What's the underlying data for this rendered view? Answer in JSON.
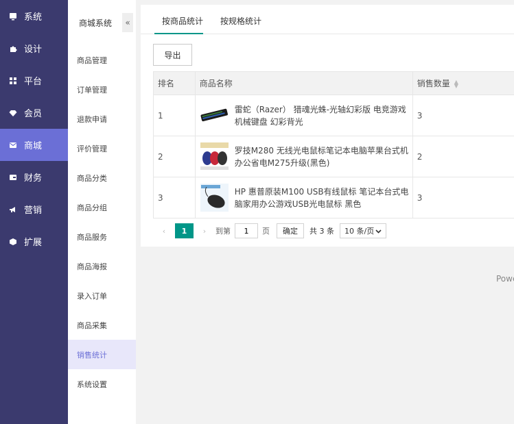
{
  "nav": {
    "items": [
      {
        "label": "系统",
        "icon": "monitor-icon"
      },
      {
        "label": "设计",
        "icon": "puzzle-icon"
      },
      {
        "label": "平台",
        "icon": "grid-icon"
      },
      {
        "label": "会员",
        "icon": "diamond-icon"
      },
      {
        "label": "商城",
        "icon": "mail-icon"
      },
      {
        "label": "财务",
        "icon": "wallet-icon"
      },
      {
        "label": "营销",
        "icon": "megaphone-icon"
      },
      {
        "label": "扩展",
        "icon": "box-icon"
      }
    ],
    "active_index": 4,
    "active_color": "#6b6fd6",
    "bg_color": "#3b3a6e"
  },
  "submenu": {
    "title": "商城系统",
    "collapse_icon": "«",
    "items": [
      "商品管理",
      "订单管理",
      "退款申请",
      "评价管理",
      "商品分类",
      "商品分组",
      "商品服务",
      "商品海报",
      "录入订单",
      "商品采集",
      "销售统计",
      "系统设置"
    ],
    "active_index": 10
  },
  "tabs": [
    {
      "label": "按商品统计",
      "active": true
    },
    {
      "label": "按规格统计",
      "active": false
    }
  ],
  "toolbar": {
    "export_label": "导出"
  },
  "table": {
    "headers": [
      "排名",
      "商品名称",
      "销售数量"
    ],
    "rows": [
      {
        "rank": "1",
        "name": "雷蛇（Razer） 猎魂光蛛-光轴幻彩版 电竞游戏机械键盘 幻彩背光",
        "qty": "3",
        "thumb": "keyboard"
      },
      {
        "rank": "2",
        "name": "罗技M280 无线光电鼠标笔记本电脑苹果台式机办公省电M275升级(黑色)",
        "qty": "2",
        "thumb": "mice"
      },
      {
        "rank": "3",
        "name": "HP 惠普原装M100 USB有线鼠标 笔记本台式电脑家用办公游戏USB光电鼠标 黑色",
        "qty": "3",
        "thumb": "mouse"
      }
    ]
  },
  "pager": {
    "prev": "‹",
    "next": "›",
    "current": "1",
    "goto_label": "到第",
    "page_value": "1",
    "page_unit": "页",
    "confirm_label": "确定",
    "total": "共 3 条",
    "page_size": "10 条/页",
    "accent": "#009688"
  },
  "footer": {
    "powered": "Powe"
  }
}
